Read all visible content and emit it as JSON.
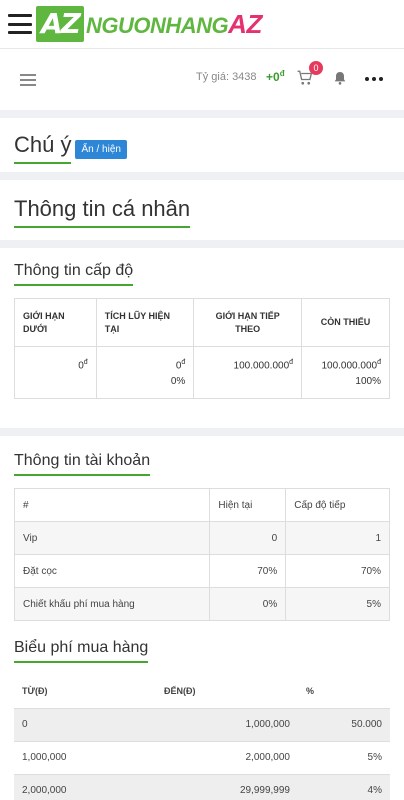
{
  "header": {
    "logo_box": "AZ",
    "logo_text": "NGUONHANG",
    "logo_accent": "AZ"
  },
  "toolbar": {
    "rate_label": "Tỷ giá: 3438",
    "wallet": "+0",
    "currency_symbol": "đ",
    "cart_count": "0"
  },
  "notice": {
    "title": "Chú ý",
    "toggle_label": "Ẩn / hiện"
  },
  "personal": {
    "title": "Thông tin cá nhân"
  },
  "level": {
    "title": "Thông tin cấp độ",
    "headers": [
      "GIỚI HẠN DƯỚI",
      "TÍCH LŨY HIỆN TẠI",
      "GIỚI HẠN TIẾP THEO",
      "CÒN THIẾU"
    ],
    "row": {
      "lower_limit": "0",
      "accumulated": "0",
      "accumulated_pct": "0%",
      "next_limit": "100.000.000",
      "remaining": "100.000.000",
      "remaining_pct": "100%"
    }
  },
  "account": {
    "title": "Thông tin tài khoản",
    "headers": [
      "#",
      "Hiện tại",
      "Cấp độ tiếp"
    ],
    "rows": [
      {
        "label": "Vip",
        "current": "0",
        "next": "1"
      },
      {
        "label": "Đặt cọc",
        "current": "70%",
        "next": "70%"
      },
      {
        "label": "Chiết khấu phí mua hàng",
        "current": "0%",
        "next": "5%"
      }
    ]
  },
  "fee": {
    "title": "Biểu phí mua hàng",
    "headers": [
      "TỪ(Đ)",
      "ĐẾN(Đ)",
      "%"
    ],
    "rows": [
      {
        "from": "0",
        "to": "1,000,000",
        "pct": "50.000"
      },
      {
        "from": "1,000,000",
        "to": "2,000,000",
        "pct": "5%"
      },
      {
        "from": "2,000,000",
        "to": "29,999,999",
        "pct": "4%"
      }
    ]
  }
}
